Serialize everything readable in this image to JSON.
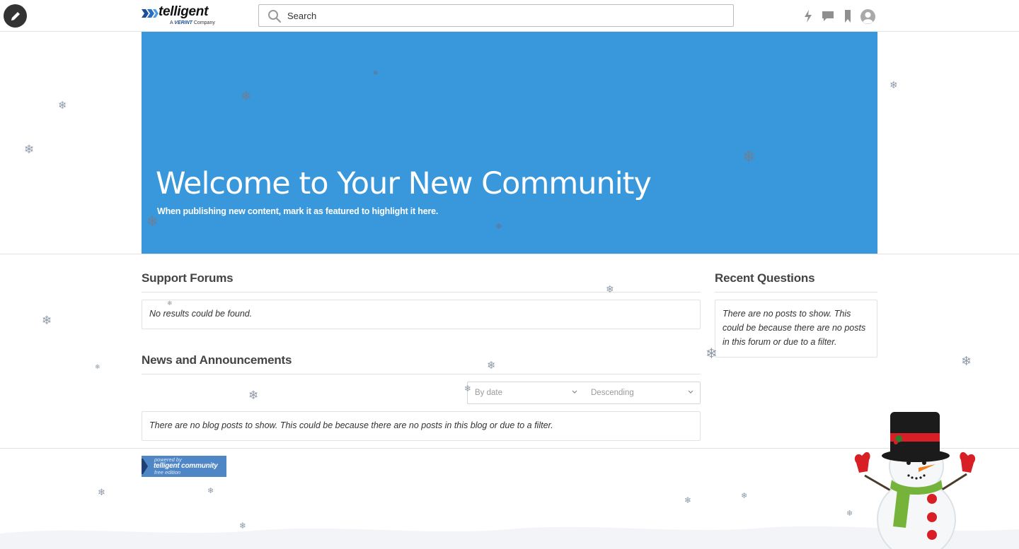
{
  "header": {
    "logo_word": "telligent",
    "logo_tagline_prefix": "A",
    "logo_tagline_brand": "VERINT",
    "logo_tagline_suffix": "Company",
    "search_placeholder": "Search",
    "icons": [
      "edit-pencil-icon",
      "activity-bolt-icon",
      "messages-icon",
      "bookmarks-icon",
      "user-avatar-icon"
    ]
  },
  "banner": {
    "title": "Welcome to Your New Community",
    "subtitle": "When publishing new content, mark it as featured to highlight it here.",
    "background": "#3997db"
  },
  "support_forums": {
    "title": "Support Forums",
    "empty_message": "No results could be found."
  },
  "news": {
    "title": "News and Announcements",
    "sort_by": "By date",
    "sort_order": "Descending",
    "empty_message": "There are no blog posts to show. This could be because there are no posts in this blog or due to a filter."
  },
  "recent_questions": {
    "title": "Recent Questions",
    "empty_message": "There are no posts to show. This could be because there are no posts in this forum or due to a filter."
  },
  "footer": {
    "powered_line1": "powered by",
    "powered_line2": "telligent community",
    "powered_line3": "free edition"
  },
  "colors": {
    "accent": "#3997db",
    "text": "#444444",
    "border": "#e2e2e2"
  }
}
